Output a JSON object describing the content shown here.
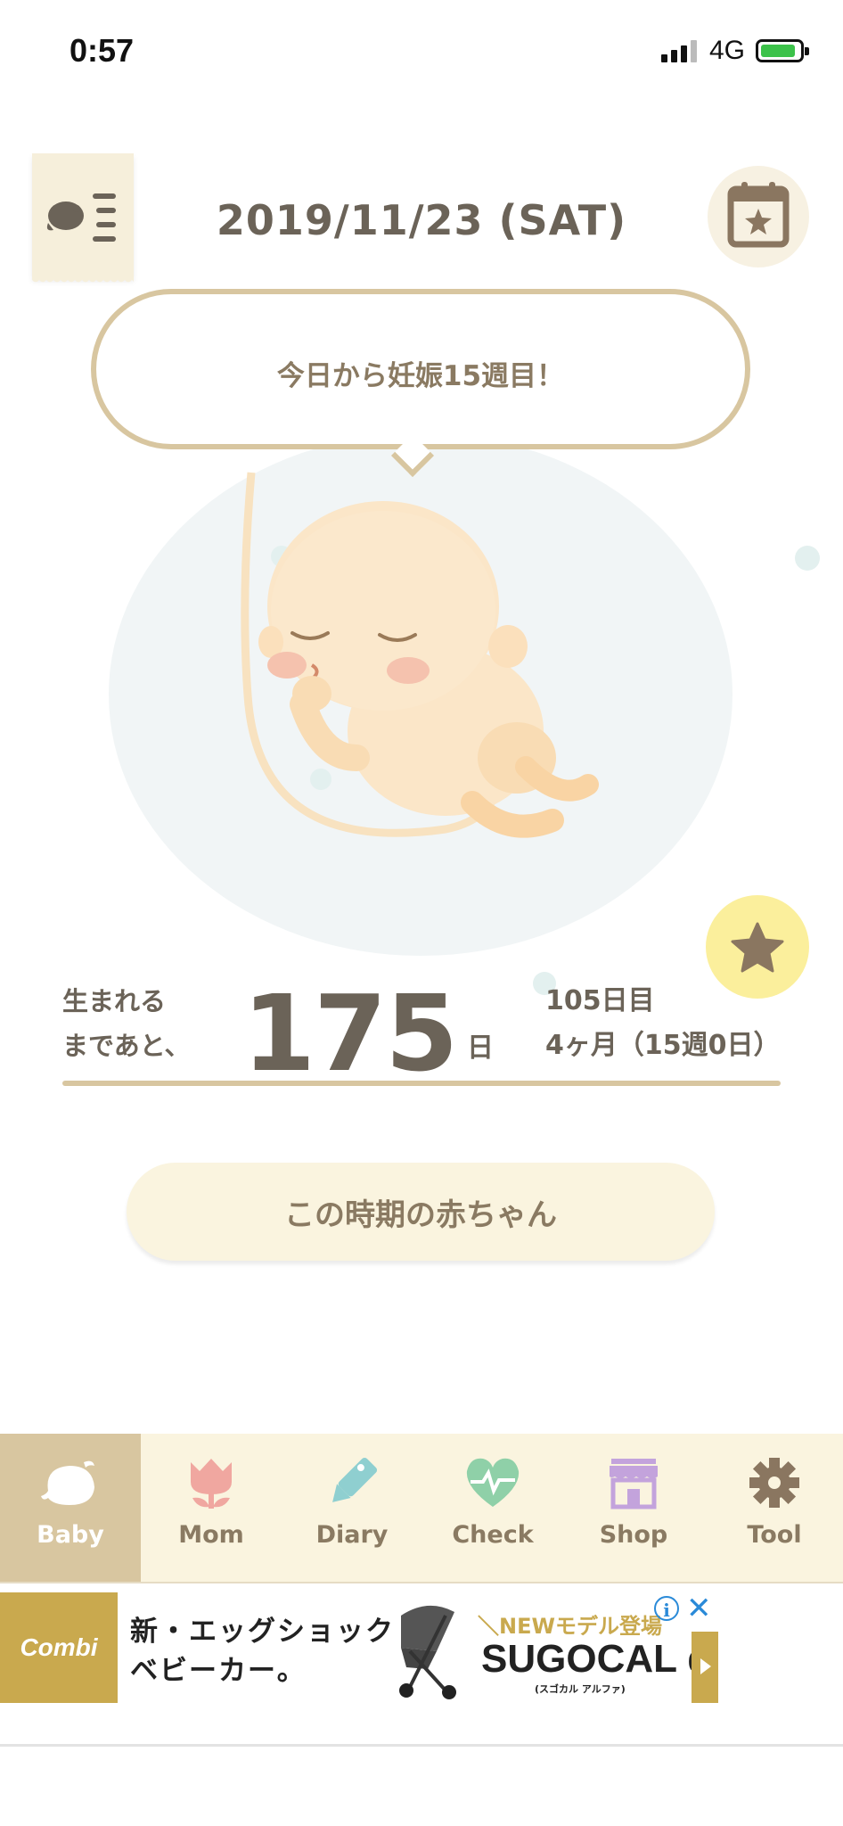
{
  "status_bar": {
    "time": "0:57",
    "network": "4G"
  },
  "header": {
    "date": "2019/11/23 (SAT)"
  },
  "bubble": {
    "message": "今日から妊娠15週目！"
  },
  "countdown": {
    "label_line1": "生まれる",
    "label_line2": "まであと、",
    "days_left": "175",
    "unit": "日",
    "day_count": "105日目",
    "month_week": "4ヶ月（15週0日）"
  },
  "baby_button": {
    "label": "この時期の赤ちゃん"
  },
  "tabs": [
    {
      "label": "Baby",
      "icon": "baby-bird-icon",
      "active": true
    },
    {
      "label": "Mom",
      "icon": "tulip-icon"
    },
    {
      "label": "Diary",
      "icon": "pencil-icon"
    },
    {
      "label": "Check",
      "icon": "heart-pulse-icon"
    },
    {
      "label": "Shop",
      "icon": "shop-icon"
    },
    {
      "label": "Tool",
      "icon": "gear-icon"
    }
  ],
  "ad": {
    "brand": "Combi",
    "headline_line1": "新・エッグショック",
    "headline_line2": "ベビーカー。",
    "new_label": "＼NEWモデル登場",
    "product": "SUGOCAL α",
    "product_sub": "(スゴカル アルファ)"
  },
  "colors": {
    "accent": "#d8c6a0",
    "cream": "#faf4df",
    "text": "#6b6358",
    "star_bg": "#fbef9c"
  }
}
